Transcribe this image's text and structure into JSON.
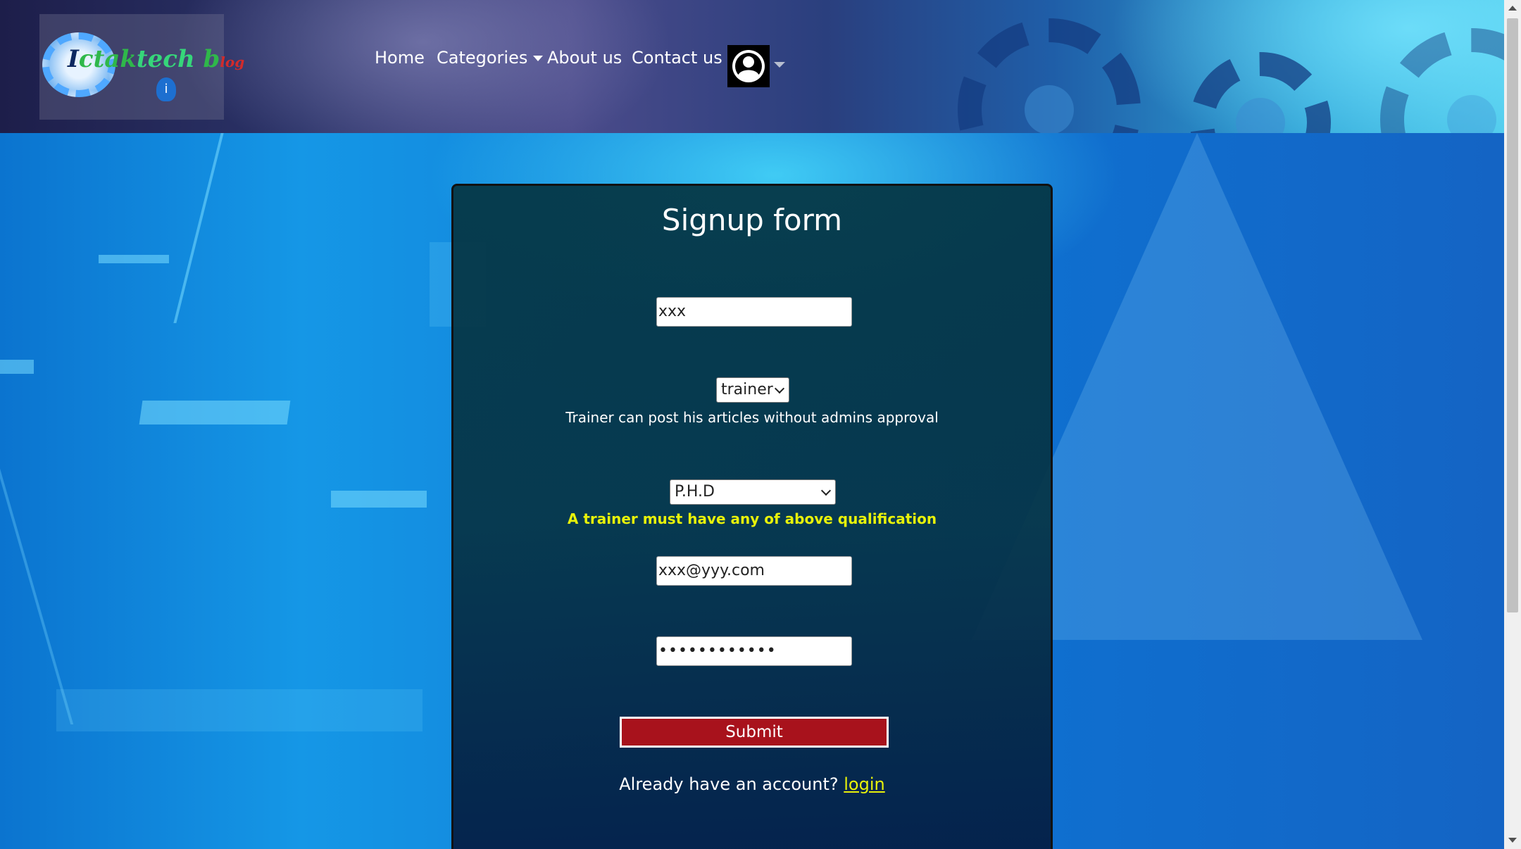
{
  "header": {
    "logo": {
      "text_parts": [
        "I",
        "ctak",
        "tech",
        " ",
        "b",
        "log"
      ],
      "icon": "logo-drop-icon"
    },
    "nav": {
      "home": "Home",
      "categories": "Categories",
      "about": "About us",
      "contact": "Contact us"
    },
    "user_icon": "user-avatar-icon"
  },
  "form": {
    "title": "Signup form",
    "username_value": "xxx",
    "role_select": "trainer",
    "role_note": "Trainer can post his articles without admins approval",
    "qualification_select": "P.H.D",
    "qualification_note": "A trainer must have any of above qualification",
    "email_value": "xxx@yyy.com",
    "password_value": "••••••••••••",
    "submit_label": "Submit",
    "login_prompt": "Already have an account? ",
    "login_link": "login"
  },
  "colors": {
    "accent_yellow": "#e8f20a",
    "submit_red": "#a8121c"
  }
}
